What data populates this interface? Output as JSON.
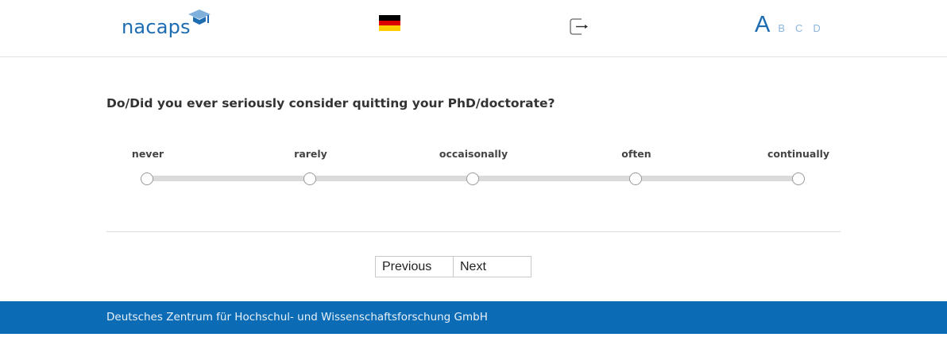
{
  "header": {
    "logo_text": "nacaps",
    "language_flag": "flag-germany-icon",
    "logout_icon": "logout-icon",
    "text_sizes": [
      "A",
      "B",
      "C",
      "D"
    ]
  },
  "question": {
    "text": "Do/Did you ever seriously consider quitting your PhD/doctorate?",
    "scale_labels": [
      "never",
      "rarely",
      "occaisonally",
      "often",
      "continually"
    ]
  },
  "navigation": {
    "previous_label": "Previous",
    "next_label": "Next"
  },
  "footer": {
    "text": "Deutsches Zentrum für Hochschul- und Wissenschaftsforschung GmbH"
  },
  "colors": {
    "brand_blue": "#1e6db3",
    "footer_blue": "#0b6cb5",
    "flag": [
      "#000000",
      "#dd0000",
      "#ffce00"
    ]
  }
}
